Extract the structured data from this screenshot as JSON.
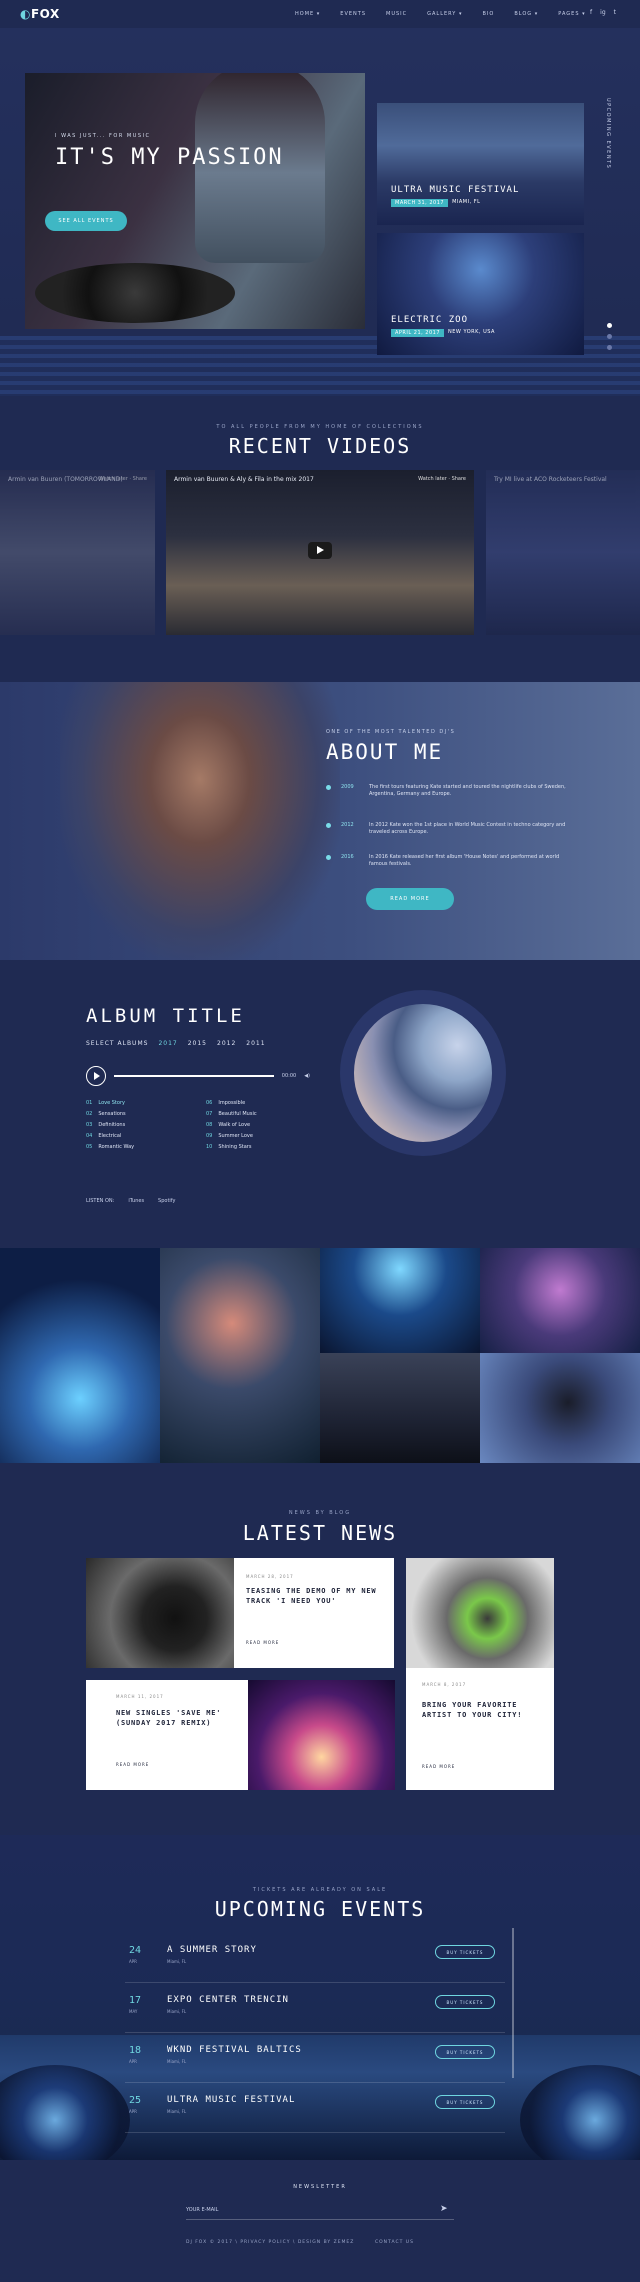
{
  "header": {
    "logo": "FOX",
    "nav": [
      "HOME ▾",
      "EVENTS",
      "MUSIC",
      "GALLERY ▾",
      "BIO",
      "BLOG ▾",
      "PAGES ▾"
    ],
    "social": [
      "f",
      "ig",
      "t"
    ]
  },
  "hero": {
    "kicker": "I WAS JUST... FOR MUSIC",
    "title": "IT'S MY PASSION",
    "button": "SEE ALL EVENTS",
    "events": [
      {
        "title": "ULTRA MUSIC FESTIVAL",
        "date": "MARCH 31, 2017",
        "place": "MIAMI, FL"
      },
      {
        "title": "ELECTRIC ZOO",
        "date": "APRIL 21, 2017",
        "place": "NEW YORK, USA"
      }
    ],
    "vertical_label": "UPCOMING EVENTS"
  },
  "videos": {
    "kicker": "TO ALL PEOPLE FROM MY HOME OF COLLECTIONS",
    "title": "RECENT VIDEOS",
    "items": [
      {
        "title": "Armin van Buuren (TOMORROWLAND)",
        "share": "Watch later · Share"
      },
      {
        "title": "Armin van Buuren & Aly & Fila in the mix 2017",
        "share": "Watch later · Share"
      },
      {
        "title": "Try MI live at ACO Rocketeers Festival",
        "share": ""
      }
    ]
  },
  "about": {
    "kicker": "ONE OF THE MOST TALENTED DJ'S",
    "title": "ABOUT ME",
    "timeline": [
      {
        "year": "2009",
        "text": "The first tours featuring Kate started and toured the nightlife clubs of Sweden, Argentina, Germany and Europe."
      },
      {
        "year": "2012",
        "text": "In 2012 Kate won the 1st place in World Music Contest in techno category and traveled across Europe."
      },
      {
        "year": "2016",
        "text": "In 2016 Kate released her first album 'House Notes' and performed at world famous festivals."
      }
    ],
    "button": "READ MORE"
  },
  "album": {
    "title": "ALBUM TITLE",
    "select_label": "SELECT ALBUMS",
    "years": [
      "2017",
      "2015",
      "2012",
      "2011"
    ],
    "active_year": "2017",
    "time": "00:00",
    "tracks": [
      {
        "n": "01",
        "name": "Love Story"
      },
      {
        "n": "06",
        "name": "Impossible"
      },
      {
        "n": "02",
        "name": "Sensations"
      },
      {
        "n": "07",
        "name": "Beautiful Music"
      },
      {
        "n": "03",
        "name": "Definitions"
      },
      {
        "n": "08",
        "name": "Walk of Love"
      },
      {
        "n": "04",
        "name": "Electrical"
      },
      {
        "n": "09",
        "name": "Summer Love"
      },
      {
        "n": "05",
        "name": "Romantic Way"
      },
      {
        "n": "10",
        "name": "Shining Stars"
      }
    ],
    "listen_on": "LISTEN ON:",
    "services": [
      "iTunes",
      "Spotify"
    ]
  },
  "news": {
    "kicker": "NEWS BY BLOG",
    "title": "LATEST NEWS",
    "posts": [
      {
        "date": "MARCH 28, 2017",
        "title": "TEASING THE DEMO OF MY NEW TRACK 'I NEED YOU'",
        "more": "READ MORE"
      },
      {
        "date": "MARCH 8, 2017",
        "title": "BRING YOUR FAVORITE ARTIST TO YOUR CITY!",
        "more": "READ MORE"
      },
      {
        "date": "MARCH 11, 2017",
        "title": "NEW SINGLES 'SAVE ME' (SUNDAY 2017 REMIX)",
        "more": "READ MORE"
      }
    ]
  },
  "events": {
    "kicker": "TICKETS ARE ALREADY ON SALE",
    "title": "UPCOMING EVENTS",
    "items": [
      {
        "day": "24",
        "mon": "APR",
        "name": "A SUMMER STORY",
        "loc": "Miami, FL",
        "btn": "BUY TICKETS"
      },
      {
        "day": "17",
        "mon": "MAY",
        "name": "EXPO CENTER TRENCIN",
        "loc": "Miami, FL",
        "btn": "BUY TICKETS"
      },
      {
        "day": "18",
        "mon": "APR",
        "name": "WKND FESTIVAL BALTICS",
        "loc": "Miami, FL",
        "btn": "BUY TICKETS"
      },
      {
        "day": "25",
        "mon": "APR",
        "name": "ULTRA MUSIC FESTIVAL",
        "loc": "Miami, FL",
        "btn": "BUY TICKETS"
      }
    ]
  },
  "footer": {
    "newsletter": "NEWSLETTER",
    "placeholder": "YOUR E-MAIL",
    "copyright": "DJ FOX © 2017 \\ PRIVACY POLICY \\ DESIGN BY ZEMEZ",
    "contact": "CONTACT US"
  },
  "colors": {
    "accent": "#3fb7c4",
    "bg": "#1f2a52"
  }
}
